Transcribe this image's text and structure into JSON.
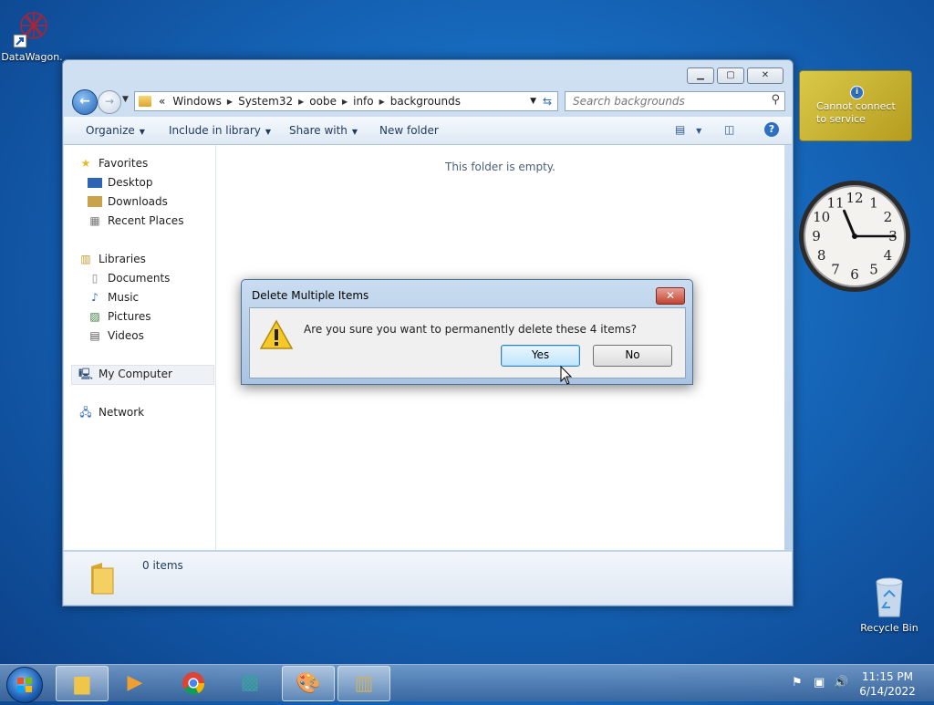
{
  "desktop": {
    "icons": [
      {
        "label": "DataWagon.",
        "icon": "datawagon-shortcut-icon"
      },
      {
        "label": "Recycle Bin",
        "icon": "recycle-bin-icon"
      }
    ]
  },
  "window": {
    "address": {
      "overflow": "«",
      "crumbs": [
        "Windows",
        "System32",
        "oobe",
        "info",
        "backgrounds"
      ]
    },
    "search": {
      "placeholder": "Search backgrounds"
    },
    "toolbar": {
      "organize": "Organize",
      "include": "Include in library",
      "share": "Share with",
      "new_folder": "New folder"
    },
    "nav": {
      "favorites": "Favorites",
      "desktop": "Desktop",
      "downloads": "Downloads",
      "recent": "Recent Places",
      "libraries": "Libraries",
      "documents": "Documents",
      "music": "Music",
      "pictures": "Pictures",
      "videos": "Videos",
      "computer": "My Computer",
      "network": "Network"
    },
    "content": {
      "empty_message": "This folder is empty."
    },
    "details": {
      "count": "0 items"
    }
  },
  "dialog": {
    "title": "Delete Multiple Items",
    "message": "Are you sure you want to permanently delete these 4 items?",
    "yes": "Yes",
    "no": "No"
  },
  "gadgets": {
    "weather": {
      "line1": "Cannot connect",
      "line2": "to service"
    },
    "clock": {
      "numerals": [
        "12",
        "1",
        "2",
        "3",
        "4",
        "5",
        "6",
        "7",
        "8",
        "9",
        "10",
        "11"
      ],
      "hour": 11,
      "minute": 15
    }
  },
  "taskbar": {
    "apps": [
      "explorer-icon",
      "media-player-icon",
      "chrome-icon",
      "app-icon",
      "paint-icon",
      "archive-icon"
    ],
    "time": "11:15 PM",
    "date": "6/14/2022"
  },
  "colors": {
    "accent": "#2d6fc1",
    "dialog_default": "#3c7fb1",
    "weather_bg": "#dac94a"
  }
}
